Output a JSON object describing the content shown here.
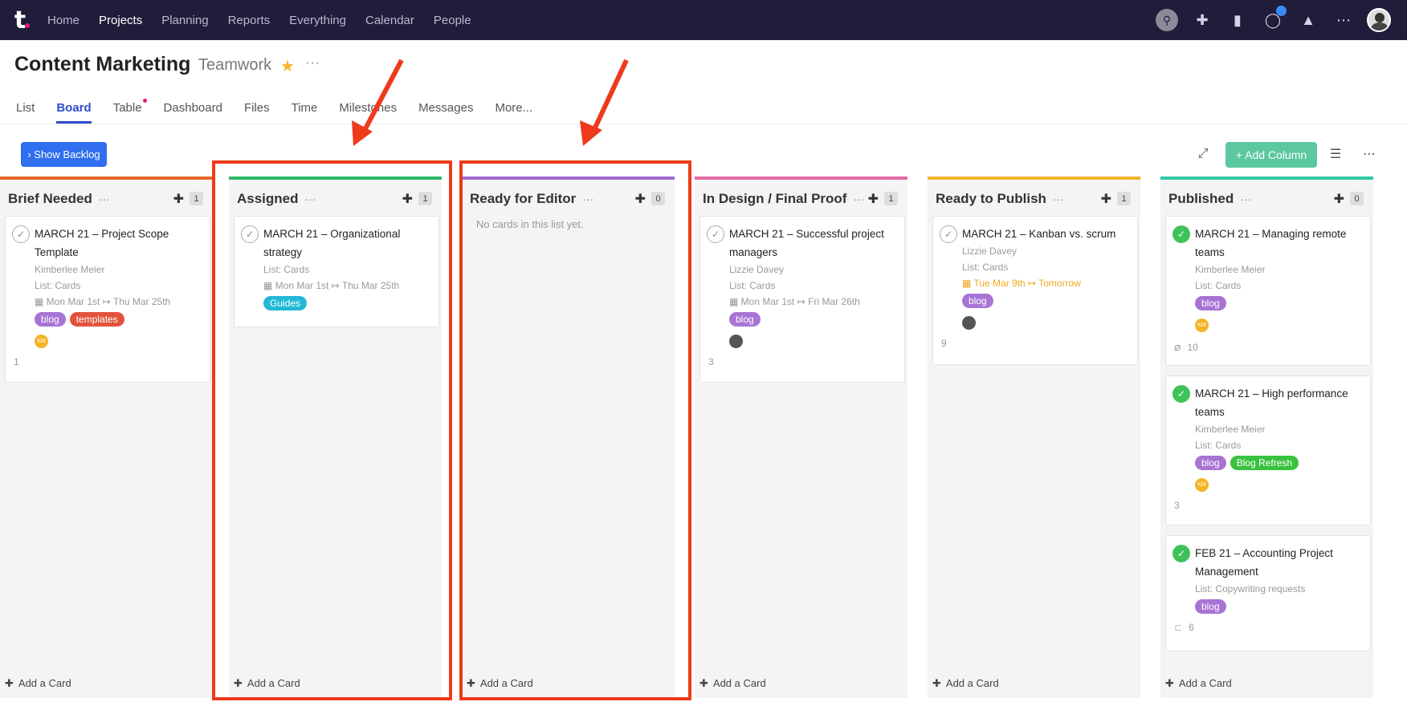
{
  "nav": {
    "logo": "t",
    "items": [
      "Home",
      "Projects",
      "Planning",
      "Reports",
      "Everything",
      "Calendar",
      "People"
    ],
    "active": "Projects",
    "icons": [
      "search-icon",
      "plus-icon",
      "folder-icon",
      "chat-icon",
      "bell-icon",
      "apps-icon",
      "avatar"
    ]
  },
  "header": {
    "title": "Content Marketing",
    "subtitle": "Teamwork",
    "more": "···"
  },
  "tabs": [
    "List",
    "Board",
    "Table",
    "Dashboard",
    "Files",
    "Time",
    "Milestones",
    "Messages",
    "More..."
  ],
  "toolbar": {
    "show_backlog": "› Show Backlog",
    "add_column": "+ Add Column"
  },
  "columns": [
    {
      "title": "Brief Needed",
      "count": "1",
      "color": "#e8672a",
      "cards": [
        {
          "title": "MARCH 21 – Project Scope Template",
          "assignee": "Kimberlee Meier",
          "list": "List: Cards",
          "dates": "Mon Mar 1st ↦ Thu Mar 25th",
          "tags": [
            "blog",
            "templates"
          ],
          "avatar": "KM",
          "comments": "1"
        }
      ]
    },
    {
      "title": "Assigned",
      "count": "1",
      "color": "#2dbb6a",
      "cards": [
        {
          "title": "MARCH 21 – Organizational strategy",
          "list": "List: Cards",
          "dates": "Mon Mar 1st ↦ Thu Mar 25th",
          "tags": [
            "Guides"
          ]
        }
      ]
    },
    {
      "title": "Ready for Editor",
      "count": "0",
      "color": "#a06bd6",
      "empty": "No cards in this list yet."
    },
    {
      "title": "In Design / Final Proof",
      "count": "1",
      "color": "#e56aa6",
      "cards": [
        {
          "title": "MARCH 21 – Successful project managers",
          "assignee": "Lizzie Davey",
          "list": "List: Cards",
          "dates": "Mon Mar 1st ↦ Fri Mar 26th",
          "tags": [
            "blog"
          ],
          "comments": "3"
        }
      ]
    },
    {
      "title": "Ready to Publish",
      "count": "1",
      "color": "#f2b52a",
      "cards": [
        {
          "title": "MARCH 21 – Kanban vs. scrum",
          "assignee": "Lizzie Davey",
          "list": "List: Cards",
          "due": "Tue Mar 9th ↦ Tomorrow",
          "tags": [
            "blog"
          ],
          "comments": "9"
        }
      ]
    },
    {
      "title": "Published",
      "count": "0",
      "color": "#2fc8a6",
      "cards": [
        {
          "title": "MARCH 21 – Managing remote teams",
          "assignee": "Kimberlee Meier",
          "list": "List: Cards",
          "tags": [
            "blog"
          ],
          "avatar": "KM",
          "attachments": "10"
        },
        {
          "title": "MARCH 21 – High performance teams",
          "assignee": "Kimberlee Meier",
          "list": "List: Cards",
          "tags": [
            "blog",
            "Blog Refresh"
          ],
          "avatar": "KM",
          "comments": "3"
        },
        {
          "title": "FEB 21 – Accounting Project Management",
          "list": "List: Copywriting requests",
          "tags": [
            "blog"
          ],
          "comments": "6"
        }
      ]
    }
  ],
  "add_card": "Add a Card",
  "colors": {
    "nav_bg": "#1f1d3a",
    "accent": "#2d4bc9",
    "annotation": "#ee3a1b"
  }
}
